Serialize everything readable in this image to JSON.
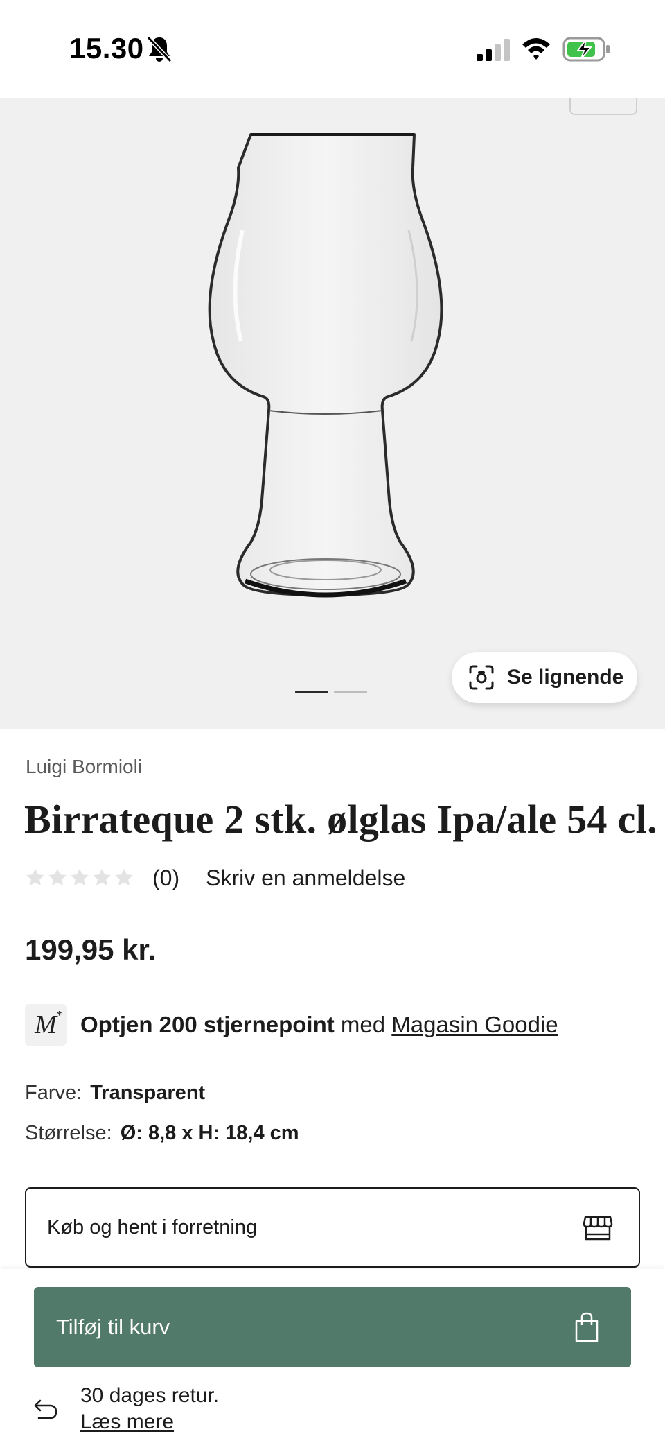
{
  "status_bar": {
    "time": "15.30",
    "icons": [
      "bell-muted-icon",
      "signal-icon",
      "wifi-icon",
      "battery-charging-icon"
    ]
  },
  "hero": {
    "image": "beer-glass-image",
    "pager": {
      "count": 2,
      "active_index": 0
    },
    "see_similar_label": "Se lignende"
  },
  "product": {
    "brand": "Luigi Bormioli",
    "title": "Birrateque 2 stk. ølglas Ipa/ale 54 cl.",
    "rating": {
      "stars": 0,
      "max_stars": 5,
      "count": "(0)",
      "write_review": "Skriv en anmeldelse"
    },
    "price": "199,95 kr.",
    "goodie": {
      "logo_text": "M",
      "logo_star": "*",
      "bold": "Optjen 200 stjernepoint",
      "mid": " med ",
      "link": "Magasin Goodie"
    },
    "attributes": {
      "color_label": "Farve:",
      "color_value": "Transparent",
      "size_label": "Størrelse:",
      "size_value": "Ø: 8,8 x H: 18,4 cm"
    },
    "store_pickup_label": "Køb og hent i forretning"
  },
  "bottom": {
    "add_to_cart_label": "Tilføj til kurv",
    "return_text": "30 dages retur.",
    "return_link": "Læs mere"
  },
  "colors": {
    "accent_green": "#527a6b",
    "hero_bg": "#f0f0f0",
    "text": "#1c1c1c"
  }
}
